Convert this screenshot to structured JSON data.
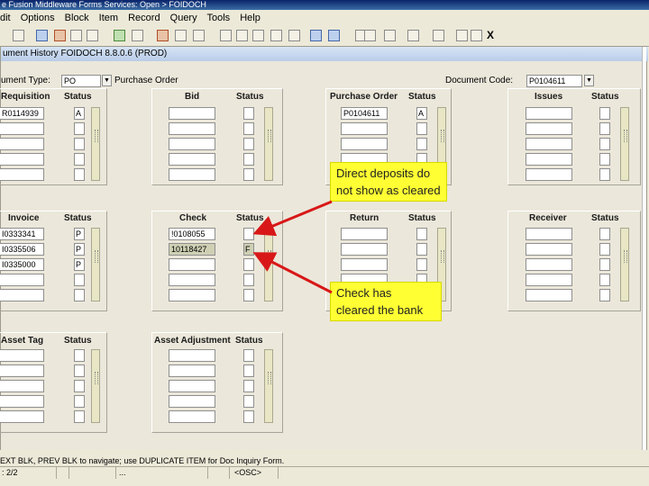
{
  "titlebar": {
    "text": "e Fusion Middleware Forms Services: Open > FOIDOCH"
  },
  "menu": {
    "items": [
      "dit",
      "Options",
      "Block",
      "Item",
      "Record",
      "Query",
      "Tools",
      "Help"
    ]
  },
  "toolbar": {
    "close_label": "X"
  },
  "form": {
    "title": "ument History  FOIDOCH  8.8.0.6  (PROD)",
    "doc_type_label": "ument Type:",
    "doc_type_value": "PO",
    "doc_type_desc": "Purchase Order",
    "doc_code_label": "Document Code:",
    "doc_code_value": "P0104611"
  },
  "panels": {
    "requisition": {
      "header": "Requisition",
      "status_header": "Status",
      "rows": [
        {
          "value": "R0114939",
          "status": "A"
        },
        {
          "value": "",
          "status": ""
        },
        {
          "value": "",
          "status": ""
        },
        {
          "value": "",
          "status": ""
        },
        {
          "value": "",
          "status": ""
        }
      ]
    },
    "bid": {
      "header": "Bid",
      "status_header": "Status",
      "rows": [
        {
          "value": "",
          "status": ""
        },
        {
          "value": "",
          "status": ""
        },
        {
          "value": "",
          "status": ""
        },
        {
          "value": "",
          "status": ""
        },
        {
          "value": "",
          "status": ""
        }
      ]
    },
    "purchase_order": {
      "header": "Purchase Order",
      "status_header": "Status",
      "rows": [
        {
          "value": "P0104611",
          "status": "A"
        },
        {
          "value": "",
          "status": ""
        },
        {
          "value": "",
          "status": ""
        },
        {
          "value": "",
          "status": ""
        },
        {
          "value": "",
          "status": ""
        }
      ]
    },
    "issues": {
      "header": "Issues",
      "status_header": "Status",
      "rows": [
        {
          "value": "",
          "status": ""
        },
        {
          "value": "",
          "status": ""
        },
        {
          "value": "",
          "status": ""
        },
        {
          "value": "",
          "status": ""
        },
        {
          "value": "",
          "status": ""
        }
      ]
    },
    "invoice": {
      "header": "Invoice",
      "status_header": "Status",
      "rows": [
        {
          "value": "I0333341",
          "status": "P"
        },
        {
          "value": "I0335506",
          "status": "P"
        },
        {
          "value": "I0335000",
          "status": "P"
        },
        {
          "value": "",
          "status": ""
        },
        {
          "value": "",
          "status": ""
        }
      ]
    },
    "check": {
      "header": "Check",
      "status_header": "Status",
      "rows": [
        {
          "value": "!0108055",
          "status": ""
        },
        {
          "value": "10118427",
          "status": "F"
        },
        {
          "value": "",
          "status": ""
        },
        {
          "value": "",
          "status": ""
        },
        {
          "value": "",
          "status": ""
        }
      ]
    },
    "return": {
      "header": "Return",
      "status_header": "Status",
      "rows": [
        {
          "value": "",
          "status": ""
        },
        {
          "value": "",
          "status": ""
        },
        {
          "value": "",
          "status": ""
        },
        {
          "value": "",
          "status": ""
        },
        {
          "value": "",
          "status": ""
        }
      ]
    },
    "receiver": {
      "header": "Receiver",
      "status_header": "Status",
      "rows": [
        {
          "value": "",
          "status": ""
        },
        {
          "value": "",
          "status": ""
        },
        {
          "value": "",
          "status": ""
        },
        {
          "value": "",
          "status": ""
        },
        {
          "value": "",
          "status": ""
        }
      ]
    },
    "asset_tag": {
      "header": "Asset Tag",
      "status_header": "Status",
      "rows": [
        {
          "value": "",
          "status": ""
        },
        {
          "value": "",
          "status": ""
        },
        {
          "value": "",
          "status": ""
        },
        {
          "value": "",
          "status": ""
        },
        {
          "value": "",
          "status": ""
        }
      ]
    },
    "asset_adjustment": {
      "header": "Asset Adjustment",
      "status_header": "Status",
      "rows": [
        {
          "value": "",
          "status": ""
        },
        {
          "value": "",
          "status": ""
        },
        {
          "value": "",
          "status": ""
        },
        {
          "value": "",
          "status": ""
        },
        {
          "value": "",
          "status": ""
        }
      ]
    }
  },
  "callouts": {
    "direct_deposit": {
      "line1": "Direct deposits do",
      "line2": "not show as cleared"
    },
    "check_cleared": {
      "line1": "Check has",
      "line2": "cleared the bank"
    }
  },
  "statusbar": {
    "message": "EXT BLK, PREV BLK to navigate; use DUPLICATE ITEM for Doc Inquiry Form.",
    "record": ": 2/2",
    "ellipsis": "...",
    "mode": "<OSC>"
  },
  "colors": {
    "callout_bg": "#ffff33",
    "arrow": "#d81818"
  }
}
